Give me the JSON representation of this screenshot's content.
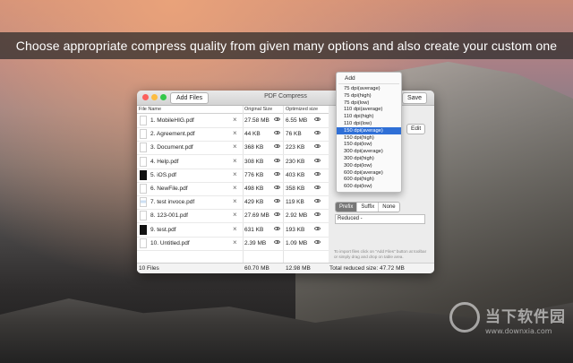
{
  "banner": {
    "text": "Choose appropriate compress quality from given many options and also create your custom one"
  },
  "window": {
    "title": "PDF Compress",
    "add_files_label": "Add Files",
    "save_label": "Save",
    "edit_label": "Edit"
  },
  "table": {
    "headers": {
      "file_name": "File Name",
      "original_size": "Original Size",
      "optimized_size": "Optimized size"
    },
    "rows": [
      {
        "name": "1. MobileHIG.pdf",
        "original": "27.58 MB",
        "optimized": "6.55 MB",
        "thumb": "plain"
      },
      {
        "name": "2. Agreement.pdf",
        "original": "44 KB",
        "optimized": "76 KB",
        "thumb": "plain"
      },
      {
        "name": "3. Document.pdf",
        "original": "368 KB",
        "optimized": "223 KB",
        "thumb": "plain"
      },
      {
        "name": "4. Help.pdf",
        "original": "308 KB",
        "optimized": "230 KB",
        "thumb": "plain"
      },
      {
        "name": "5. iOS.pdf",
        "original": "776 KB",
        "optimized": "403 KB",
        "thumb": "dark"
      },
      {
        "name": "6. NewFile.pdf",
        "original": "498 KB",
        "optimized": "358 KB",
        "thumb": "plain"
      },
      {
        "name": "7. test invoce.pdf",
        "original": "429 KB",
        "optimized": "119 KB",
        "thumb": "blue"
      },
      {
        "name": "8. 123-001.pdf",
        "original": "27.69 MB",
        "optimized": "2.92 MB",
        "thumb": "plain"
      },
      {
        "name": "9. test.pdf",
        "original": "631 KB",
        "optimized": "193 KB",
        "thumb": "dark"
      },
      {
        "name": "10. Untitled.pdf",
        "original": "2.39 MB",
        "optimized": "1.09 MB",
        "thumb": "plain"
      }
    ]
  },
  "footer": {
    "file_count": "10 Files",
    "total_original": "60.70 MB",
    "total_optimized": "12.98 MB",
    "reduced": "Total reduced size: 47.72 MB"
  },
  "dropdown": {
    "header": "Add",
    "options": [
      "75 dpi(average)",
      "75 dpi(high)",
      "75 dpi(low)",
      "110 dpi(average)",
      "110 dpi(high)",
      "110 dpi(low)",
      "150 dpi(average)",
      "150 dpi(high)",
      "150 dpi(low)",
      "300 dpi(average)",
      "300 dpi(high)",
      "300 dpi(low)",
      "600 dpi(average)",
      "600 dpi(high)",
      "600 dpi(low)"
    ],
    "selected_index": 6
  },
  "naming": {
    "segments": [
      "Prefix",
      "Suffix",
      "None"
    ],
    "active": 0,
    "prefix_value": "Reduced -"
  },
  "hint": "To import files click on \"Add Files\" button at toolbar or simply drag and drop on table area.",
  "watermark": {
    "text": "当下软件园",
    "url": "www.downxia.com"
  },
  "colors": {
    "selection": "#2f6fd6",
    "close": "#fc605c",
    "minimize": "#fdbc40",
    "zoom": "#34c84a"
  }
}
